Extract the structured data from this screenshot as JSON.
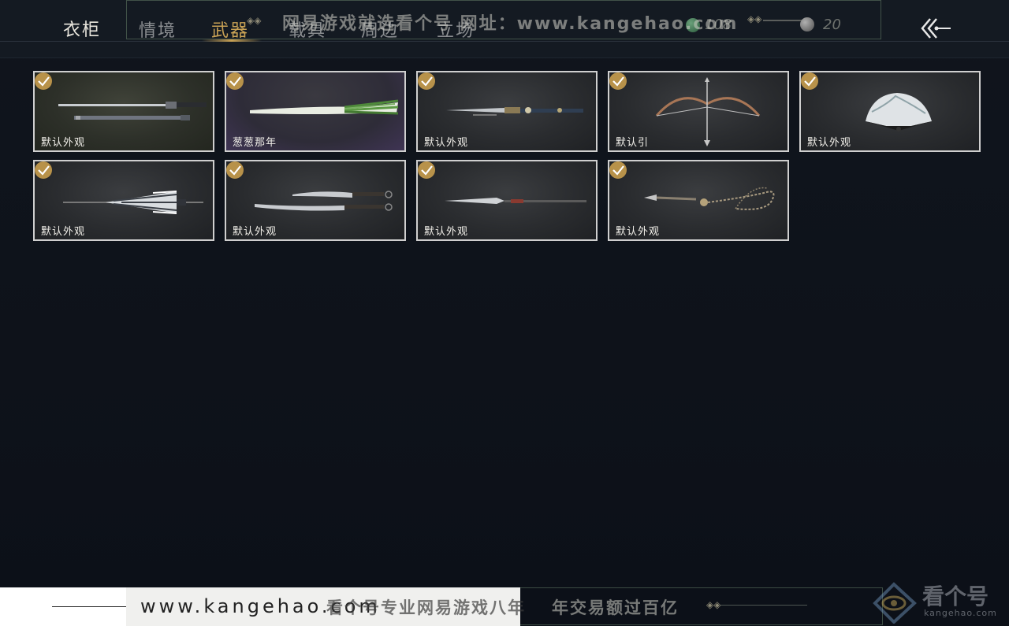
{
  "header": {
    "title": "衣柜",
    "tabs": [
      {
        "label": "情境",
        "active": false
      },
      {
        "label": "武器",
        "active": true
      },
      {
        "label": "载具",
        "active": false
      },
      {
        "label": "周边",
        "active": false
      },
      {
        "label": "立场",
        "active": false
      }
    ],
    "currency_value": "108",
    "slider_value": "20",
    "back_icon": "back-arrow-icon"
  },
  "weapons": [
    {
      "label": "默认外观",
      "icon": "sword-icon",
      "selected": true
    },
    {
      "label": "葱葱那年",
      "icon": "scallion-icon",
      "selected": true
    },
    {
      "label": "默认外观",
      "icon": "ornate-sword-icon",
      "selected": true
    },
    {
      "label": "默认引",
      "icon": "bow-icon",
      "selected": true
    },
    {
      "label": "默认外观",
      "icon": "fan-icon",
      "selected": true
    },
    {
      "label": "默认外观",
      "icon": "umbrella-icon",
      "selected": true
    },
    {
      "label": "默认外观",
      "icon": "dual-blades-icon",
      "selected": true
    },
    {
      "label": "默认外观",
      "icon": "glaive-icon",
      "selected": true
    },
    {
      "label": "默认外观",
      "icon": "rope-dart-icon",
      "selected": true
    }
  ],
  "watermark": {
    "top_text": "网易游戏就选看个号  网址：www.kangehao.com",
    "bottom_url": "www.kangehao.com",
    "bottom_text_1": "看个号专业网易游戏八年",
    "bottom_text_2": "年交易额过百亿",
    "logo_text": "看个号",
    "logo_url": "kangehao.com"
  },
  "colors": {
    "accent_gold": "#c9a255",
    "background": "#0d1119",
    "card_border": "#cfcfcf"
  }
}
